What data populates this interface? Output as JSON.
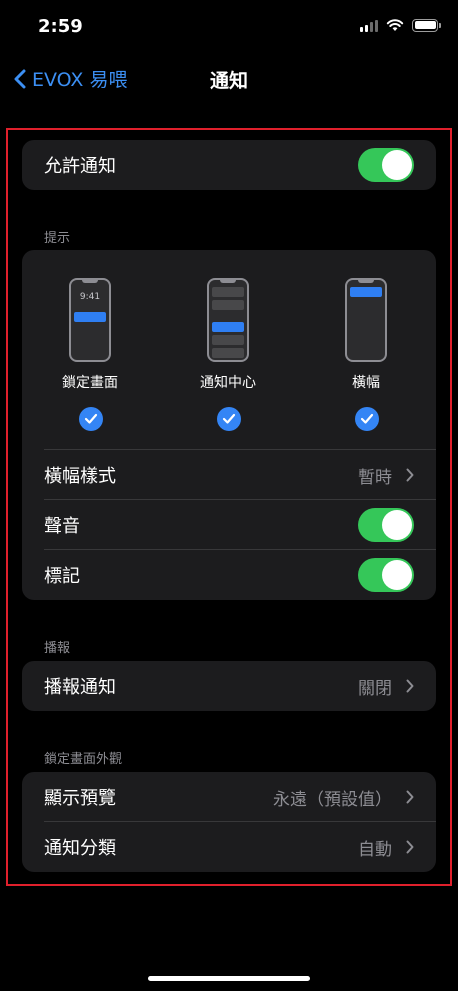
{
  "status_bar": {
    "time": "2:59"
  },
  "nav": {
    "back_label": "EVOX 易喂",
    "title": "通知"
  },
  "allow": {
    "label": "允許通知",
    "on": true
  },
  "alerts": {
    "header": "提示",
    "options": [
      {
        "label": "鎖定畫面",
        "checked": true,
        "preview_time": "9:41"
      },
      {
        "label": "通知中心",
        "checked": true
      },
      {
        "label": "橫幅",
        "checked": true
      }
    ],
    "banner_style": {
      "label": "橫幅樣式",
      "value": "暫時"
    },
    "sounds": {
      "label": "聲音",
      "on": true
    },
    "badges": {
      "label": "標記",
      "on": true
    }
  },
  "announce": {
    "header": "播報",
    "row": {
      "label": "播報通知",
      "value": "關閉"
    }
  },
  "lock_screen": {
    "header": "鎖定畫面外觀",
    "show_previews": {
      "label": "顯示預覽",
      "value": "永遠（預設值）"
    },
    "grouping": {
      "label": "通知分類",
      "value": "自動"
    }
  },
  "colors": {
    "accent": "#3c8ff3",
    "toggle_on": "#35c759",
    "check": "#3485f5",
    "highlight_frame": "#e0202c"
  }
}
